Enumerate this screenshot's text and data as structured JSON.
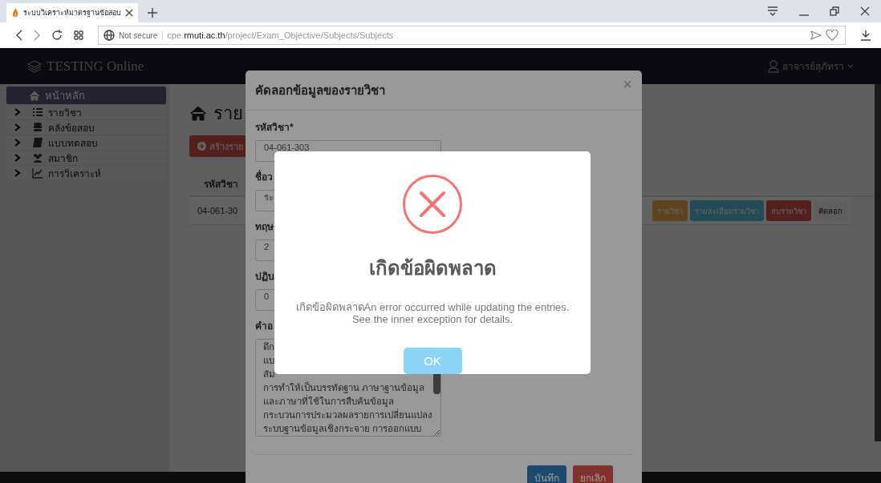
{
  "browser": {
    "tab": {
      "title": "ระบบวิเคราะห์มาตรฐานข้อสอบ"
    },
    "address": {
      "security": "Not secure",
      "url": "cpe.**rmuti.ac.th**/project/Exam_Objective/Subjects/Subjects"
    }
  },
  "navbar": {
    "brand": "TESTING Online",
    "user": "อาจารย์สุภัทรา"
  },
  "sidebar": {
    "items": [
      {
        "label": "หน้าหลัก",
        "selected": true,
        "kind": "home"
      },
      {
        "label": "รายวิชา",
        "selected": false,
        "kind": "list"
      },
      {
        "label": "คลังข้อสอบ",
        "selected": false,
        "kind": "database"
      },
      {
        "label": "แบบทดสอบ",
        "selected": false,
        "kind": "book"
      },
      {
        "label": "สมาชิก",
        "selected": false,
        "kind": "users"
      },
      {
        "label": "การวิเคราะห์",
        "selected": false,
        "kind": "chart"
      }
    ]
  },
  "main": {
    "heading": "ราย",
    "create_button": "สร้างราย",
    "table": {
      "columns": [
        "รหัสวิชา"
      ],
      "rows": [
        {
          "code": "04-061-30",
          "actions": [
            {
              "label": "รายวิชา",
              "kind": "edit"
            },
            {
              "label": "รายละเอียดรายวิชา",
              "kind": "info"
            },
            {
              "label": "ลบรายวิชา",
              "kind": "delete"
            },
            {
              "label": "คัดลอก",
              "kind": "copy"
            }
          ]
        }
      ]
    }
  },
  "modal": {
    "title": "คัดลอกข้อมูลของรายวิชา",
    "close": "×",
    "fields": [
      {
        "kind": "input",
        "label": "รหัสวิชา*",
        "value": "04-061-303"
      },
      {
        "kind": "input",
        "label": "ชื่อว",
        "value": "ระ"
      },
      {
        "kind": "input",
        "label": "ทฤษ",
        "value": "2"
      },
      {
        "kind": "input",
        "label": "ปฏิบ",
        "value": "0"
      },
      {
        "kind": "textarea",
        "label": "คำอ",
        "lines": [
          "ดึก",
          "แบ",
          "สัม",
          "การทำให้เป็นบรรทัดฐาน ภาษาฐานข้อมูล",
          "และภาษาที่ใช้ในการสืบค้นข้อมูล",
          "กระบวนการประมวลผลรายการเปลี่ยนแปลง",
          "ระบบฐานข้อมูลเชิงกระจาย การออกแบบ"
        ]
      }
    ],
    "buttons": [
      {
        "label": "บันทึก",
        "kind": "primary"
      },
      {
        "label": "ยกเลิก",
        "kind": "danger"
      }
    ]
  },
  "alert": {
    "title": "เกิดข้อผิดพลาด",
    "message": "เกิดข้อผิดพลาดAn error occurred while updating the entries. See the inner exception for details.",
    "button": "OK"
  }
}
